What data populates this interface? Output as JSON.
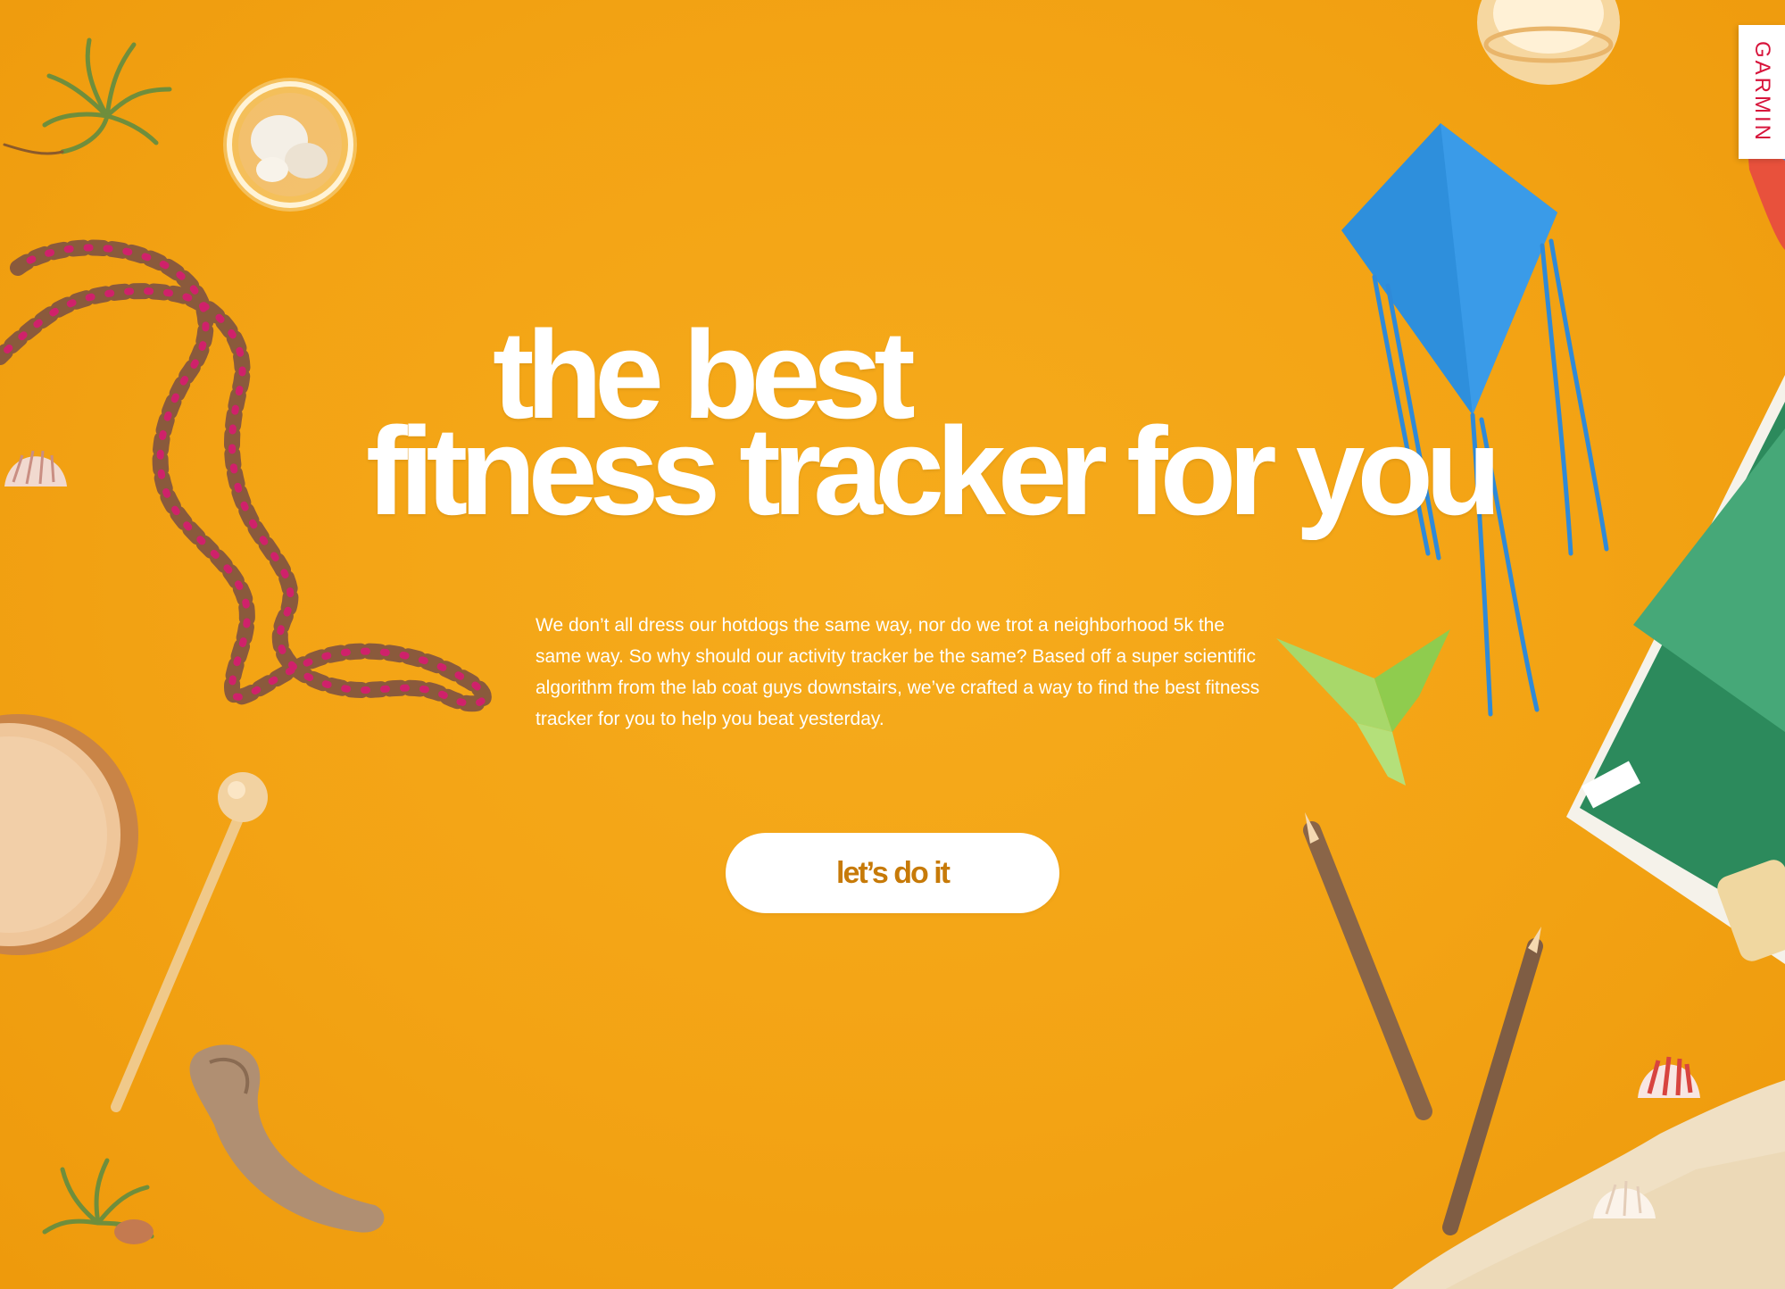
{
  "brand": {
    "name": "GARMIN",
    "color": "#d7143b"
  },
  "hero": {
    "title_line1": "the best",
    "title_line2": "fitness tracker for you"
  },
  "intro": {
    "text": "We don’t all dress our hotdogs the same way, nor do we trot a neighborhood 5k the same way. So why should our activity tracker be the same? Based off a super scientific algorithm from the lab coat guys downstairs, we’ve crafted a way to find the best fitness tracker for you to help you beat yesterday."
  },
  "cta": {
    "label": "let’s do it"
  },
  "theme": {
    "background": "#f3a314",
    "text": "#ffffff",
    "button_text": "#c77a08"
  },
  "decorations": [
    "air-plant-icon",
    "shell-jar-icon",
    "bead-necklace-icon",
    "seashell-icon",
    "drum-icon",
    "mallet-icon",
    "driftwood-icon",
    "paper-kite-icon",
    "origami-bird-icon",
    "twig-pencil-icon",
    "magazine-icon",
    "candle-jar-icon",
    "sand-icon"
  ]
}
